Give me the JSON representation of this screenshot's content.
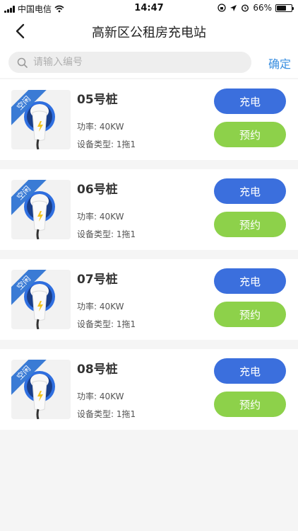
{
  "status_bar": {
    "carrier": "中国电信",
    "time": "14:47",
    "battery": "66%",
    "battery_level": 0.66
  },
  "nav": {
    "title": "高新区公租房充电站"
  },
  "search": {
    "placeholder": "请输入编号",
    "confirm_label": "确定"
  },
  "stations": [
    {
      "status": "空闲",
      "name": "05号桩",
      "power": "功率: 40KW",
      "device_type": "设备类型: 1拖1",
      "charge_label": "充电",
      "reserve_label": "预约"
    },
    {
      "status": "空闲",
      "name": "06号桩",
      "power": "功率: 40KW",
      "device_type": "设备类型: 1拖1",
      "charge_label": "充电",
      "reserve_label": "预约"
    },
    {
      "status": "空闲",
      "name": "07号桩",
      "power": "功率: 40KW",
      "device_type": "设备类型: 1拖1",
      "charge_label": "充电",
      "reserve_label": "预约"
    },
    {
      "status": "空闲",
      "name": "08号桩",
      "power": "功率: 40KW",
      "device_type": "设备类型: 1拖1",
      "charge_label": "充电",
      "reserve_label": "预约"
    }
  ],
  "colors": {
    "accent_blue": "#3b6fdd",
    "reserve_green": "#8dd14a",
    "link_blue": "#3a8fe0",
    "ribbon_blue": "#3a7bd5"
  },
  "icons": {
    "back": "chevron-left-icon",
    "search": "search-icon",
    "charger": "ev-charger-icon",
    "wifi": "wifi-icon",
    "location": "location-arrow-icon",
    "alarm": "alarm-clock-icon",
    "lock_rotation": "orientation-lock-icon",
    "battery": "battery-icon"
  }
}
